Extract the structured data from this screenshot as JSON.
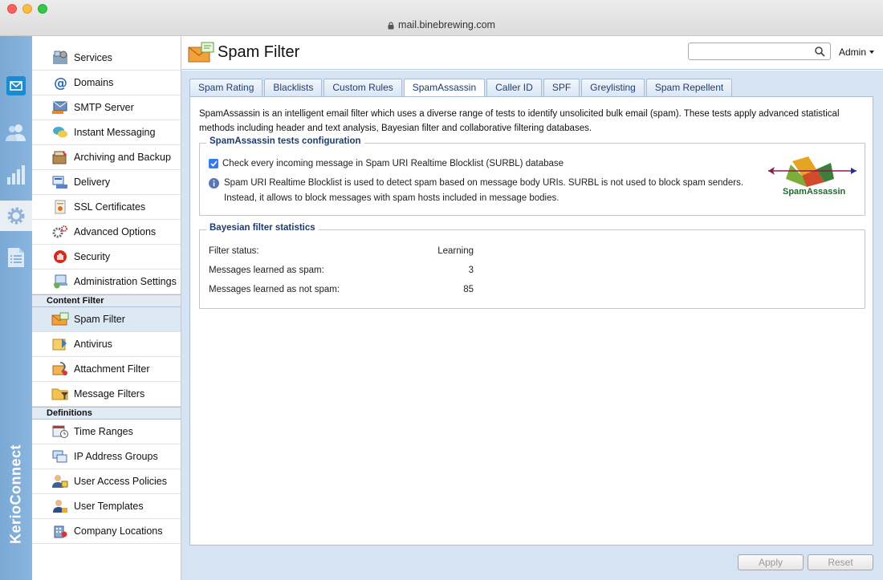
{
  "browser": {
    "url": "mail.binebrewing.com"
  },
  "rail": {
    "brand": "KerioConnect"
  },
  "sidebar": {
    "items": [
      {
        "label": "Services",
        "icon": "services-icon"
      },
      {
        "label": "Domains",
        "icon": "at-sign-icon"
      },
      {
        "label": "SMTP Server",
        "icon": "mail-server-icon"
      },
      {
        "label": "Instant Messaging",
        "icon": "chat-bubbles-icon"
      },
      {
        "label": "Archiving and Backup",
        "icon": "archive-box-icon"
      },
      {
        "label": "Delivery",
        "icon": "delivery-icon"
      },
      {
        "label": "SSL Certificates",
        "icon": "certificate-icon"
      },
      {
        "label": "Advanced Options",
        "icon": "gears-icon"
      },
      {
        "label": "Security",
        "icon": "stop-hand-icon"
      },
      {
        "label": "Administration Settings",
        "icon": "admin-settings-icon"
      }
    ],
    "content_filter_label": "Content Filter",
    "content_filter_items": [
      {
        "label": "Spam Filter",
        "icon": "spam-envelope-icon"
      },
      {
        "label": "Antivirus",
        "icon": "antivirus-icon"
      },
      {
        "label": "Attachment Filter",
        "icon": "attachment-filter-icon"
      },
      {
        "label": "Message Filters",
        "icon": "folder-filter-icon"
      }
    ],
    "definitions_label": "Definitions",
    "definition_items": [
      {
        "label": "Time Ranges",
        "icon": "calendar-clock-icon"
      },
      {
        "label": "IP Address Groups",
        "icon": "network-group-icon"
      },
      {
        "label": "User Access Policies",
        "icon": "user-policy-icon"
      },
      {
        "label": "User Templates",
        "icon": "user-template-icon"
      },
      {
        "label": "Company Locations",
        "icon": "building-icon"
      }
    ]
  },
  "header": {
    "title": "Spam Filter",
    "search_value": "",
    "user": "Admin"
  },
  "tabs": [
    "Spam Rating",
    "Blacklists",
    "Custom Rules",
    "SpamAssassin",
    "Caller ID",
    "SPF",
    "Greylisting",
    "Spam Repellent"
  ],
  "active_tab": "SpamAssassin",
  "panel": {
    "description": "SpamAssassin is an intelligent email filter which uses a diverse range of tests to identify unsolicited bulk email (spam). These tests apply advanced statistical methods including header and text analysis, Bayesian filter and collaborative filtering databases.",
    "config": {
      "title": "SpamAssassin tests configuration",
      "checkbox_label": "Check every incoming message in Spam URI Realtime Blocklist (SURBL) database",
      "checked": true,
      "info": "Spam URI Realtime Blocklist is used to detect spam based on message body URIs. SURBL is not used to block spam senders. Instead, it allows to block messages with spam hosts included in message bodies.",
      "logo_text": "SpamAssassin"
    },
    "stats": {
      "title": "Bayesian filter statistics",
      "rows": [
        {
          "label": "Filter status:",
          "value": "Learning"
        },
        {
          "label": "Messages learned as spam:",
          "value": "3"
        },
        {
          "label": "Messages learned as not spam:",
          "value": "85"
        }
      ]
    }
  },
  "buttons": {
    "apply": "Apply",
    "reset": "Reset"
  }
}
